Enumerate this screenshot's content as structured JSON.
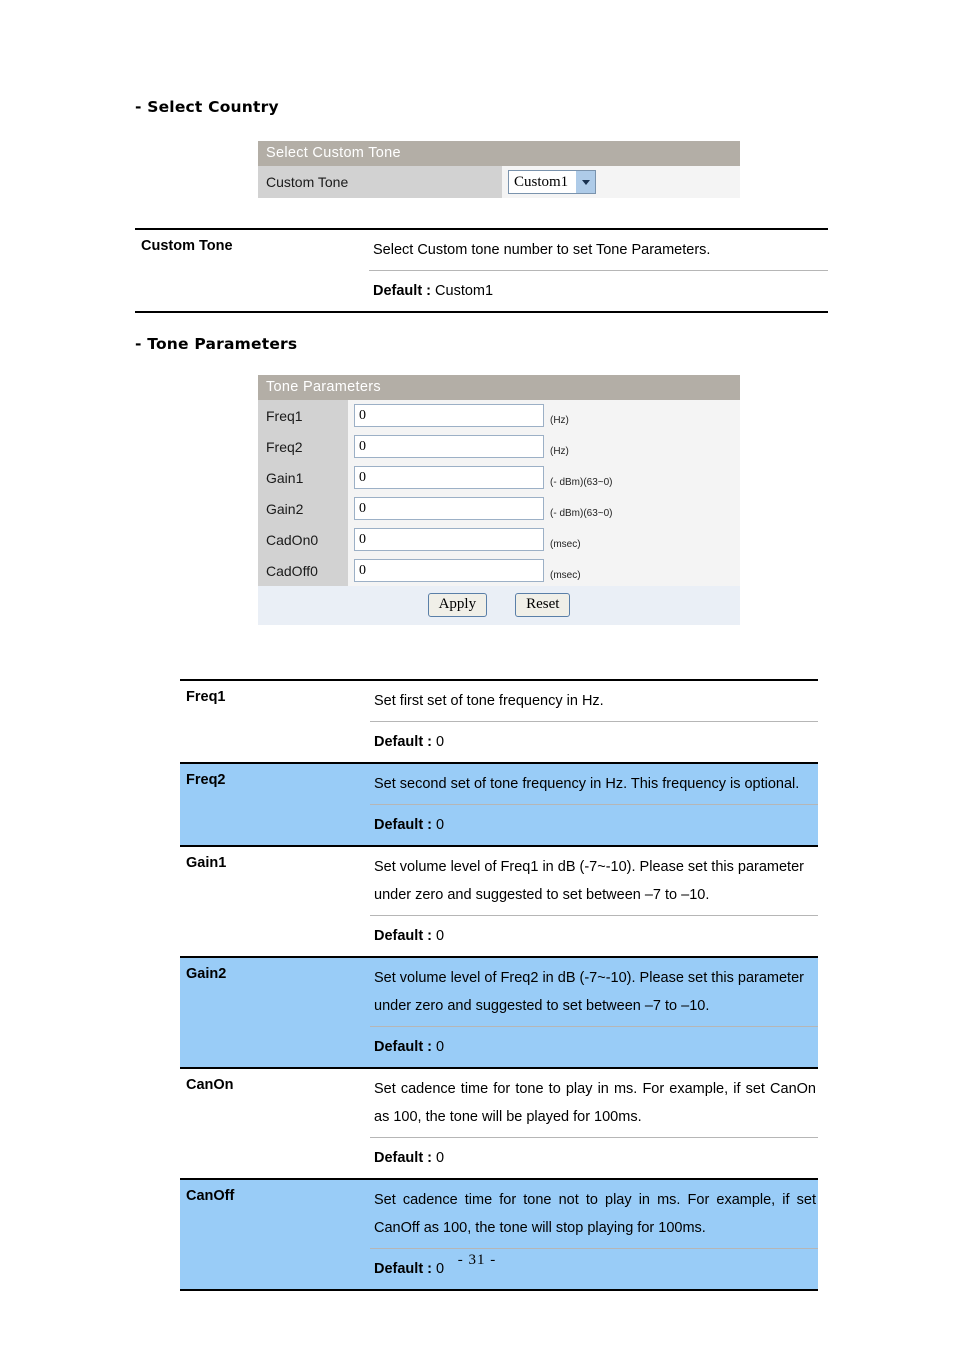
{
  "page": {
    "footer": "- 31 -"
  },
  "sections": {
    "select_country": {
      "heading": "- Select Country",
      "form": {
        "bar_title": "Select Custom Tone",
        "row_label": "Custom Tone",
        "select_value": "Custom1",
        "select_icon": "chevron-down-icon"
      },
      "desc_table": {
        "rows": [
          {
            "term": "Custom Tone",
            "description": "Select Custom tone number to set Tone Parameters.",
            "default_label": "Default :",
            "default_value": "Custom1",
            "highlight": false
          }
        ]
      }
    },
    "tone_parameters": {
      "heading": "- Tone Parameters",
      "form": {
        "bar_title": "Tone Parameters",
        "fields": [
          {
            "label": "Freq1",
            "value": "0",
            "unit": "(Hz)"
          },
          {
            "label": "Freq2",
            "value": "0",
            "unit": "(Hz)"
          },
          {
            "label": "Gain1",
            "value": "0",
            "unit": "(- dBm)(63~0)"
          },
          {
            "label": "Gain2",
            "value": "0",
            "unit": "(- dBm)(63~0)"
          },
          {
            "label": "CadOn0",
            "value": "0",
            "unit": "(msec)"
          },
          {
            "label": "CadOff0",
            "value": "0",
            "unit": "(msec)"
          }
        ],
        "apply_label": "Apply",
        "reset_label": "Reset"
      },
      "desc_table": {
        "rows": [
          {
            "term": "Freq1",
            "description": "Set first set of tone frequency in Hz.",
            "default_label": "Default :",
            "default_value": "0",
            "highlight": false,
            "justify": false
          },
          {
            "term": "Freq2",
            "description": "Set second set of tone frequency in Hz. This frequency is optional.",
            "default_label": "Default :",
            "default_value": "0",
            "highlight": true,
            "justify": false
          },
          {
            "term": "Gain1",
            "description": "Set volume level of Freq1 in dB (-7~-10). Please set this parameter under zero and suggested to set between –7 to –10.",
            "default_label": "Default :",
            "default_value": "0",
            "highlight": false,
            "justify": false
          },
          {
            "term": "Gain2",
            "description": "Set volume level of Freq2 in dB (-7~-10). Please set this parameter under zero and suggested to set between –7 to –10.",
            "default_label": "Default :",
            "default_value": "0",
            "highlight": true,
            "justify": false
          },
          {
            "term": "CanOn",
            "description": "Set cadence time for tone to play in ms. For example, if set CanOn as 100, the tone will be played for 100ms.",
            "default_label": "Default :",
            "default_value": "0",
            "highlight": false,
            "justify": true
          },
          {
            "term": "CanOff",
            "description": "Set cadence time for tone not to play in ms. For example, if set CanOff as 100, the tone will stop playing for 100ms.",
            "default_label": "Default :",
            "default_value": "0",
            "highlight": true,
            "justify": true
          }
        ]
      }
    }
  }
}
